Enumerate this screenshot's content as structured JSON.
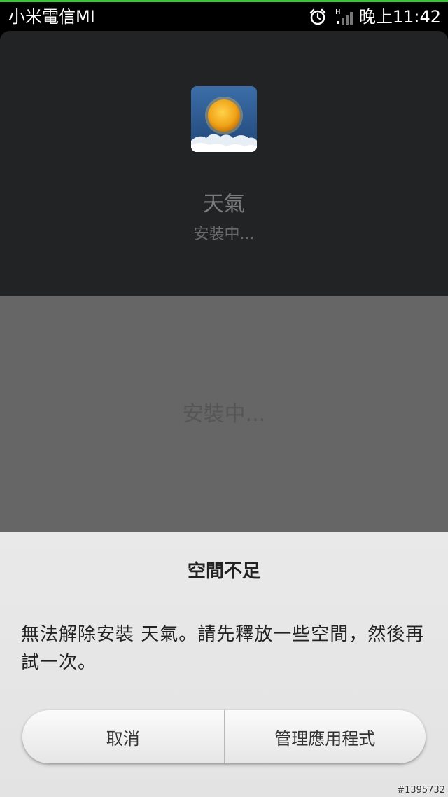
{
  "status_bar": {
    "carrier": "小米電信MI",
    "network_type": "H",
    "time": "晚上11:42",
    "icons": [
      "alarm-clock-icon",
      "signal-strength-icon"
    ]
  },
  "installer": {
    "app_name": "天氣",
    "app_status": "安裝中...",
    "progress_text": "安裝中...",
    "app_icon": "weather-sun-cloud-icon"
  },
  "dialog": {
    "title": "空間不足",
    "message": "無法解除安裝 天氣。請先釋放一些空間，然後再試一次。",
    "buttons": {
      "cancel": "取消",
      "manage": "管理應用程式"
    }
  },
  "watermark": "#1395732",
  "colors": {
    "status_accent": "#39c43a",
    "installer_top": "#222325",
    "installer_mid": "#666666",
    "dialog_bg": "#e9e9e9"
  }
}
